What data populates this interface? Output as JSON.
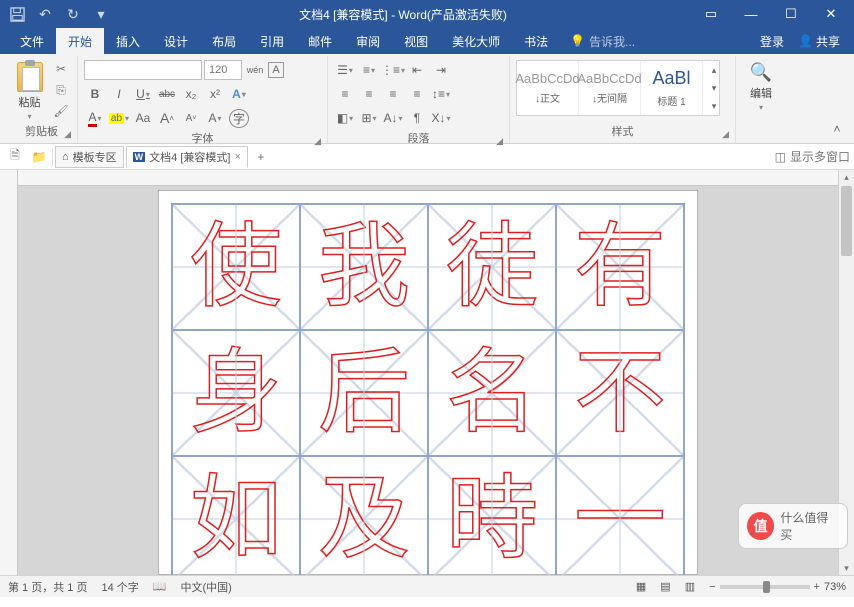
{
  "title": "文档4 [兼容模式] - Word(产品激活失败)",
  "qat": {
    "save": "💾",
    "undo": "↶",
    "redo": "↻",
    "more": "▾"
  },
  "winctrl": {
    "opts": "▭",
    "min": "—",
    "max": "☐",
    "close": "✕"
  },
  "menu": {
    "items": [
      "文件",
      "开始",
      "插入",
      "设计",
      "布局",
      "引用",
      "邮件",
      "审阅",
      "视图",
      "美化大师",
      "书法"
    ],
    "active": 1,
    "tell": "告诉我...",
    "tell_icon": "💡",
    "login": "登录",
    "share": "共享"
  },
  "ribbon": {
    "clipboard": {
      "label": "剪贴板",
      "paste": "粘贴",
      "cut": "✂",
      "copy": "⎘",
      "painter": "🖌"
    },
    "font": {
      "label": "字体",
      "family": "",
      "size": "120",
      "grow": "A",
      "shrink": "A",
      "clear": "Aa",
      "phonetic": "wén",
      "charbox": "A",
      "bold": "B",
      "italic": "I",
      "underline": "U",
      "strike": "abc",
      "sub": "x₂",
      "sup": "x²",
      "effects": "A",
      "highlight": "ab",
      "color": "A"
    },
    "para": {
      "label": "段落"
    },
    "styles": {
      "label": "样式",
      "items": [
        {
          "prev": "AaBbCcDd",
          "name": "↓正文"
        },
        {
          "prev": "AaBbCcDd",
          "name": "↓无间隔"
        },
        {
          "prev": "AaBl",
          "name": "标题 1",
          "h": true
        }
      ]
    },
    "edit": {
      "label": "编辑",
      "find": "🔍"
    },
    "collapse": "˄"
  },
  "tabs": {
    "template": "模板专区",
    "doc": "文档4 [兼容模式]",
    "new": "+",
    "multiwin": "显示多窗口"
  },
  "doc": {
    "chars": [
      "使",
      "我",
      "徒",
      "有",
      "身",
      "后",
      "名",
      "不",
      "如",
      "及",
      "時",
      "一"
    ]
  },
  "status": {
    "page": "第 1 页，共 1 页",
    "words": "14 个字",
    "lang": "中文(中国)",
    "zoom_minus": "−",
    "zoom_plus": "+",
    "zoom": "73%"
  },
  "watermark": {
    "text": "什么值得买"
  }
}
